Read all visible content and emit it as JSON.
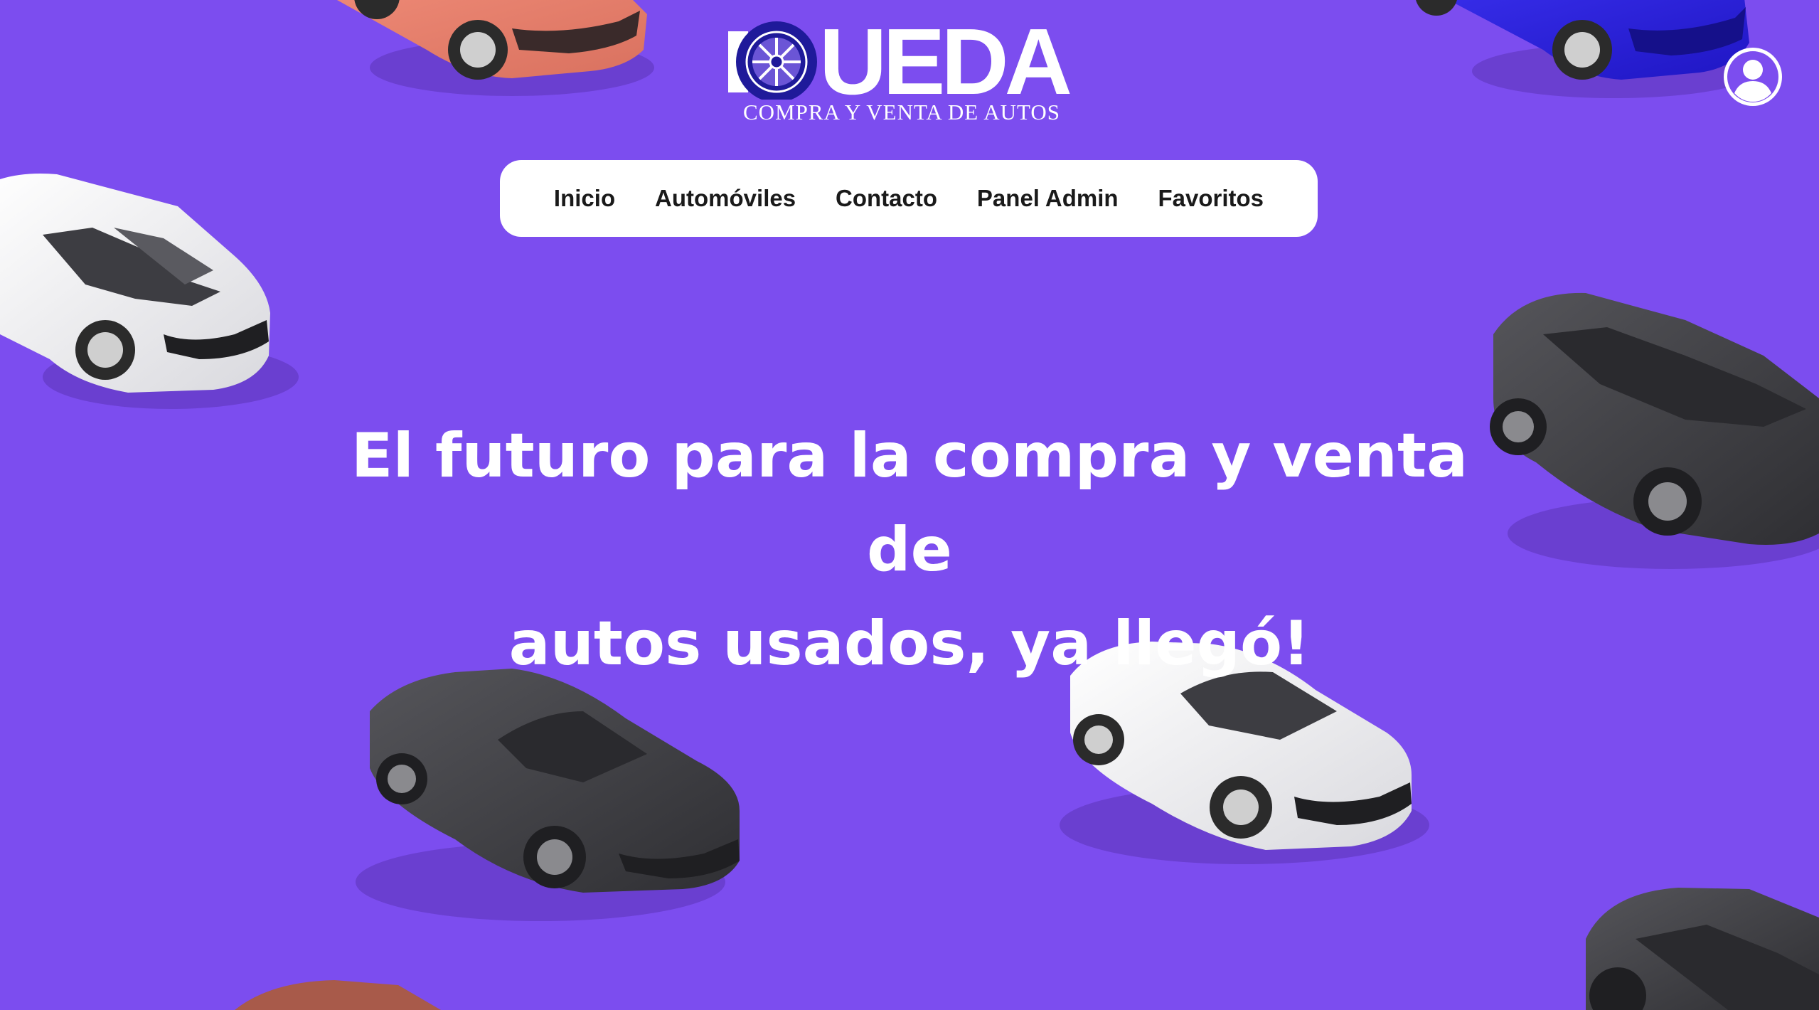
{
  "brand": {
    "name": "RUEDA",
    "word_shown": "UEDA",
    "tagline": "COMPRA Y VENTA DE AUTOS",
    "wheel_color": "#1f1a9a",
    "text_color": "#ffffff"
  },
  "nav": {
    "items": [
      {
        "label": "Inicio"
      },
      {
        "label": "Automóviles"
      },
      {
        "label": "Contacto"
      },
      {
        "label": "Panel Admin"
      },
      {
        "label": "Favoritos"
      }
    ]
  },
  "hero": {
    "title_line1": "El futuro para la compra y venta de",
    "title_line2": "autos usados, ya llegó!"
  },
  "profile": {
    "icon": "user-circle-icon"
  },
  "colors": {
    "background": "#7c4def",
    "nav_background": "#ffffff",
    "car_colors": [
      "#e8806d",
      "#2a1fd6",
      "#f4f4f4",
      "#3a3a3c",
      "#a85a4a"
    ]
  }
}
